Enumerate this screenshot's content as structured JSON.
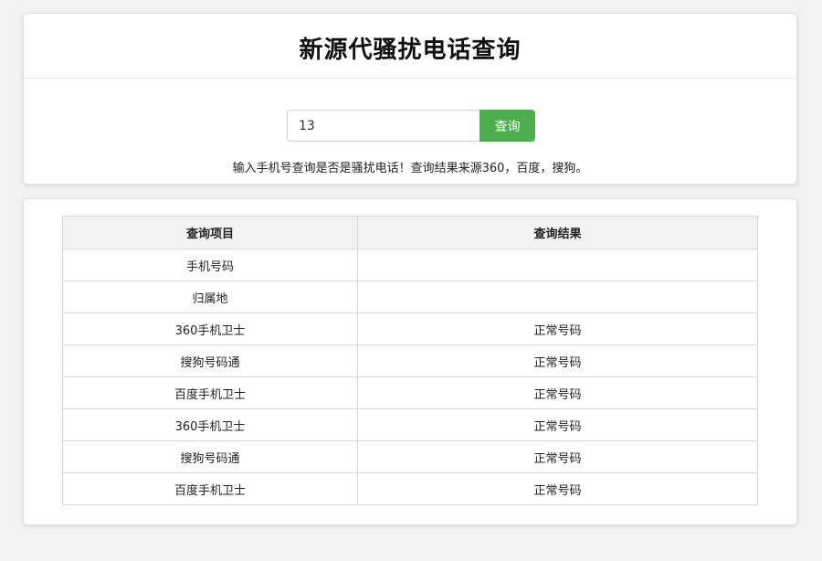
{
  "header": {
    "title": "新源代骚扰电话查询"
  },
  "search": {
    "value": "13",
    "button_label": "查询",
    "hint": "输入手机号查询是否是骚扰电话！查询结果来源360，百度，搜狗。"
  },
  "table": {
    "columns": [
      "查询项目",
      "查询结果"
    ],
    "rows": [
      {
        "item": "手机号码",
        "result": ""
      },
      {
        "item": "归属地",
        "result": ""
      },
      {
        "item": "360手机卫士",
        "result": "正常号码"
      },
      {
        "item": "搜狗号码通",
        "result": "正常号码"
      },
      {
        "item": "百度手机卫士",
        "result": "正常号码"
      },
      {
        "item": "360手机卫士",
        "result": "正常号码"
      },
      {
        "item": "搜狗号码通",
        "result": "正常号码"
      },
      {
        "item": "百度手机卫士",
        "result": "正常号码"
      }
    ]
  },
  "colors": {
    "accent": "#4cae4c",
    "background": "#f2f2f2",
    "header_row": "#f2f2f2"
  }
}
